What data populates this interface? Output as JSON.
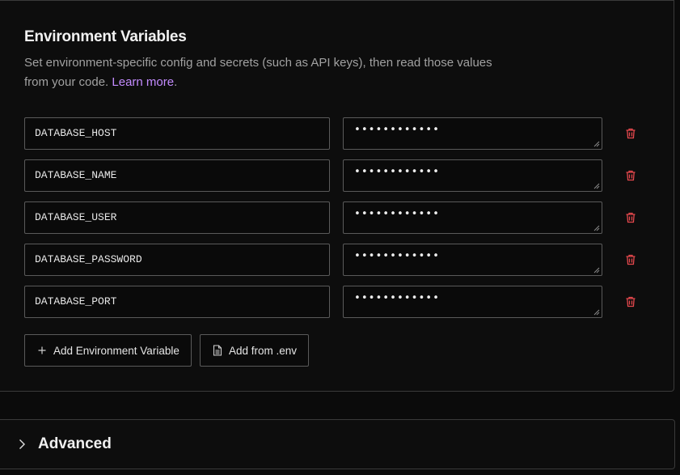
{
  "section": {
    "title": "Environment Variables",
    "description_prefix": "Set environment-specific config and secrets (such as API keys), then read those values from your code. ",
    "learn_more": "Learn more",
    "description_suffix": "."
  },
  "variables": [
    {
      "key": "DATABASE_HOST",
      "value": "••••••••••••"
    },
    {
      "key": "DATABASE_NAME",
      "value": "••••••••••••"
    },
    {
      "key": "DATABASE_USER",
      "value": "••••••••••••"
    },
    {
      "key": "DATABASE_PASSWORD",
      "value": "••••••••••••"
    },
    {
      "key": "DATABASE_PORT",
      "value": "••••••••••••"
    }
  ],
  "actions": {
    "add_variable": "Add Environment Variable",
    "add_from_env": "Add from .env"
  },
  "advanced": {
    "label": "Advanced"
  },
  "colors": {
    "accent_link": "#c38bff",
    "delete_icon": "#e5484d",
    "border": "#5a5a5a",
    "background": "#0b0b0b"
  },
  "icons": {
    "delete": "trash-icon",
    "add": "plus-icon",
    "file": "file-icon",
    "expand": "chevron-right-icon"
  }
}
